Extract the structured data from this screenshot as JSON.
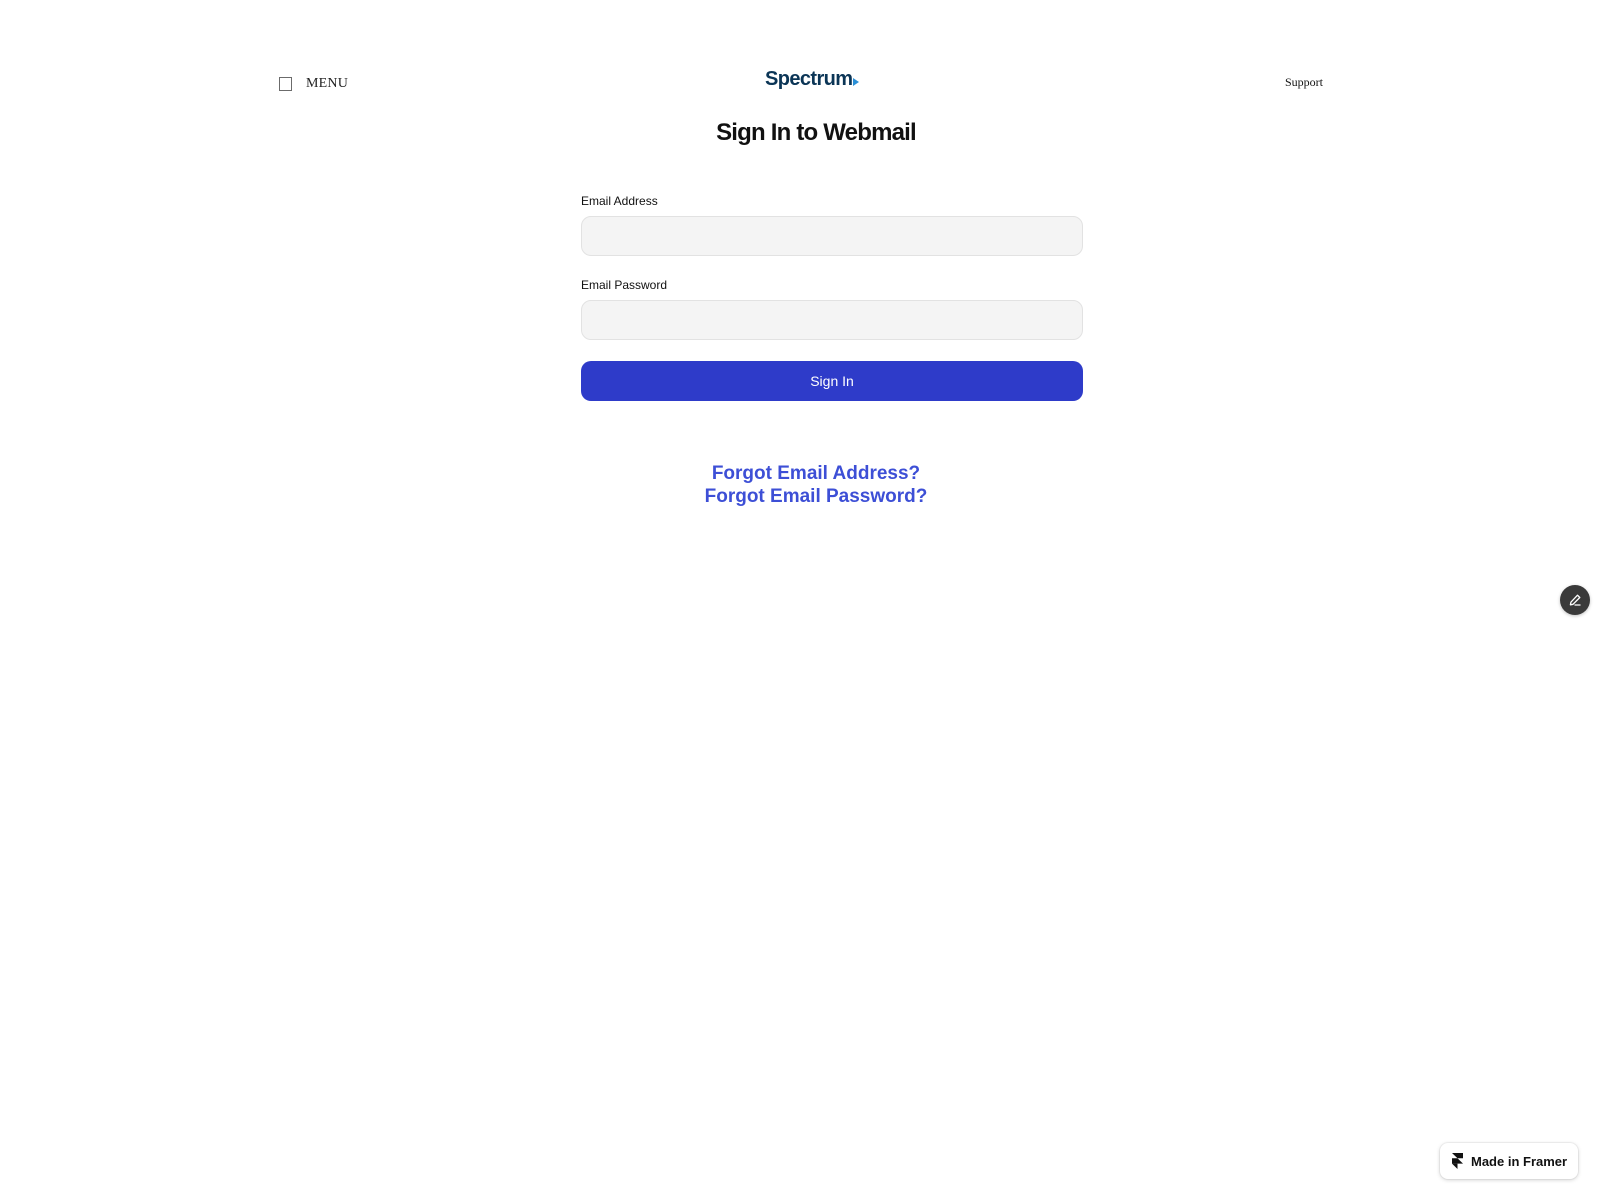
{
  "header": {
    "menu_label": "MENU",
    "logo_text": "Spectrum",
    "support_label": "Support"
  },
  "page": {
    "title": "Sign In to Webmail"
  },
  "form": {
    "email_label": "Email Address",
    "email_value": "",
    "email_placeholder": "",
    "password_label": "Email Password",
    "password_value": "",
    "password_placeholder": "",
    "signin_label": "Sign In"
  },
  "links": {
    "forgot_email": "Forgot Email Address?",
    "forgot_password": "Forgot Email Password?"
  },
  "badge": {
    "label": "Made in Framer"
  },
  "icons": {
    "menu": "checkbox-icon",
    "logo_arrow": "play-arrow-icon",
    "edit": "pencil-icon",
    "framer": "framer-logo-icon"
  },
  "colors": {
    "primary_button": "#2e3bc9",
    "link": "#3d4fd6",
    "logo_text": "#0b3556",
    "logo_arrow": "#2a8fd6",
    "input_bg": "#f4f4f4"
  }
}
